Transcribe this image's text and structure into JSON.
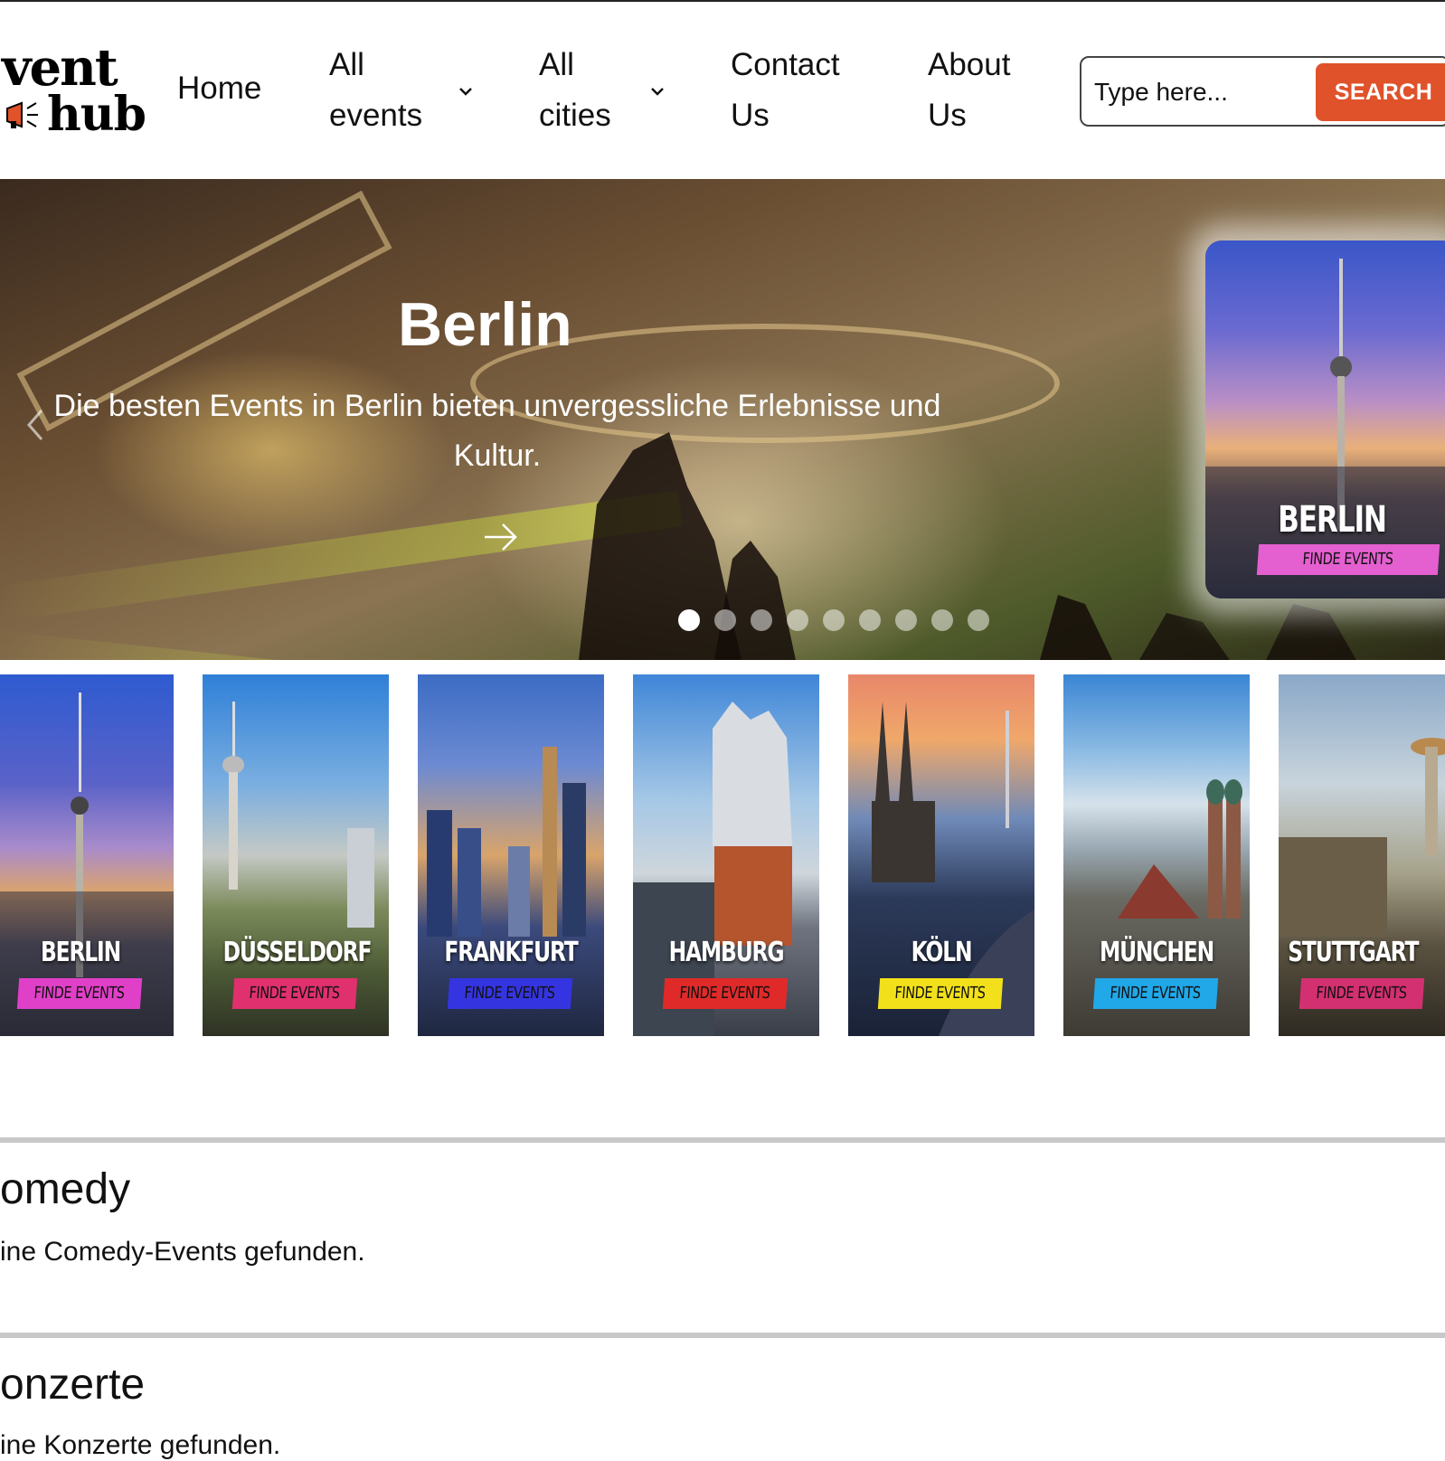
{
  "header": {
    "logo_top": "vent",
    "logo_bottom": "hub",
    "nav": {
      "home": "Home",
      "all_events_1": "All",
      "all_events_2": "events",
      "all_cities_1": "All",
      "all_cities_2": "cities",
      "contact_1": "Contact",
      "contact_2": "Us",
      "about_1": "About",
      "about_2": "Us"
    },
    "search": {
      "placeholder": "Type here...",
      "button": "SEARCH"
    }
  },
  "hero": {
    "title": "Berlin",
    "subtitle": "Die besten Events in Berlin bieten unvergessliche Erlebnisse und Kultur.",
    "slide_count": 9,
    "active_slide": 1,
    "feature_card": {
      "city": "BERLIN",
      "button": "FINDE EVENTS",
      "button_color": "#e45fd0"
    }
  },
  "cities": [
    {
      "name": "BERLIN",
      "button": "FINDE EVENTS",
      "button_color": "#e040c8"
    },
    {
      "name": "DÜSSELDORF",
      "button": "FINDE EVENTS",
      "button_color": "#e0306e"
    },
    {
      "name": "FRANKFURT",
      "button": "FINDE EVENTS",
      "button_color": "#3434e0"
    },
    {
      "name": "HAMBURG",
      "button": "FINDE EVENTS",
      "button_color": "#e02a2a"
    },
    {
      "name": "KÖLN",
      "button": "FINDE EVENTS",
      "button_color": "#f2e11a"
    },
    {
      "name": "MÜNCHEN",
      "button": "FINDE EVENTS",
      "button_color": "#20a8e8"
    },
    {
      "name": "STUTTGART",
      "button": "FINDE EVENTS",
      "button_color": "#d23070"
    }
  ],
  "sections": [
    {
      "title": "omedy",
      "text": "ine Comedy-Events gefunden."
    },
    {
      "title": "onzerte",
      "text": "ine Konzerte gefunden."
    }
  ],
  "colors": {
    "accent": "#e0522a"
  }
}
